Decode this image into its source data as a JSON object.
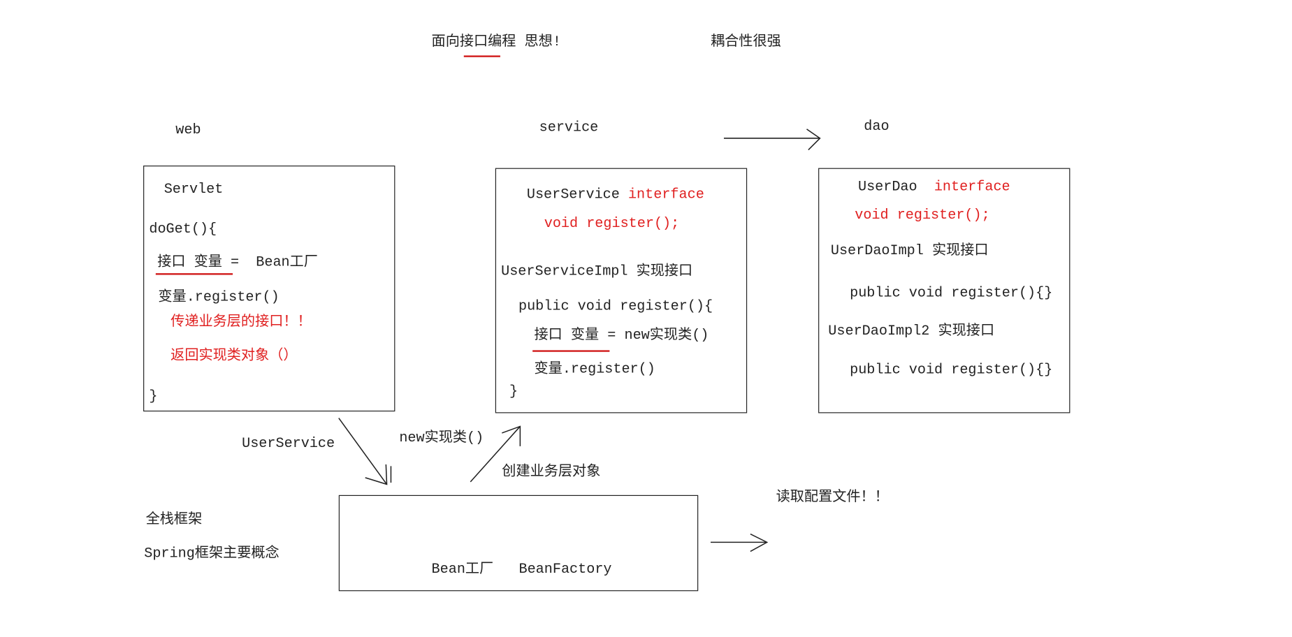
{
  "colors": {
    "text": "#222222",
    "accent": "#e02020"
  },
  "header": {
    "title": "面向接口编程 思想!",
    "coupling": "耦合性很强"
  },
  "layers": {
    "web": "web",
    "service": "service",
    "dao": "dao"
  },
  "web_box": {
    "servlet": "Servlet",
    "doget": "doGet(){",
    "assign": "接口 变量 =  Bean工厂",
    "call": "变量.register()",
    "note1": "传递业务层的接口！！",
    "note2": "返回实现类对象（）",
    "close": "}"
  },
  "service_box": {
    "iface_name": "UserService",
    "iface_kw": "interface",
    "method": "void register();",
    "impl": "UserServiceImpl 实现接口",
    "impl_method": "public void register(){",
    "assign": "接口 变量 = new实现类()",
    "call": "变量.register()",
    "close": "}"
  },
  "dao_box": {
    "iface_name": "UserDao",
    "iface_kw": "interface",
    "method": "void register();",
    "impl1": "UserDaoImpl 实现接口",
    "impl1_method": "public void register(){}",
    "impl2": "UserDaoImpl2 实现接口",
    "impl2_method": "public void register(){}"
  },
  "labels": {
    "user_service": "UserService",
    "new_impl": "new实现类()",
    "create_service": "创建业务层对象",
    "full_stack": "全栈框架",
    "spring_concept": "Spring框架主要概念",
    "read_config": "读取配置文件！！"
  },
  "factory_box": {
    "label": "Bean工厂   BeanFactory"
  }
}
